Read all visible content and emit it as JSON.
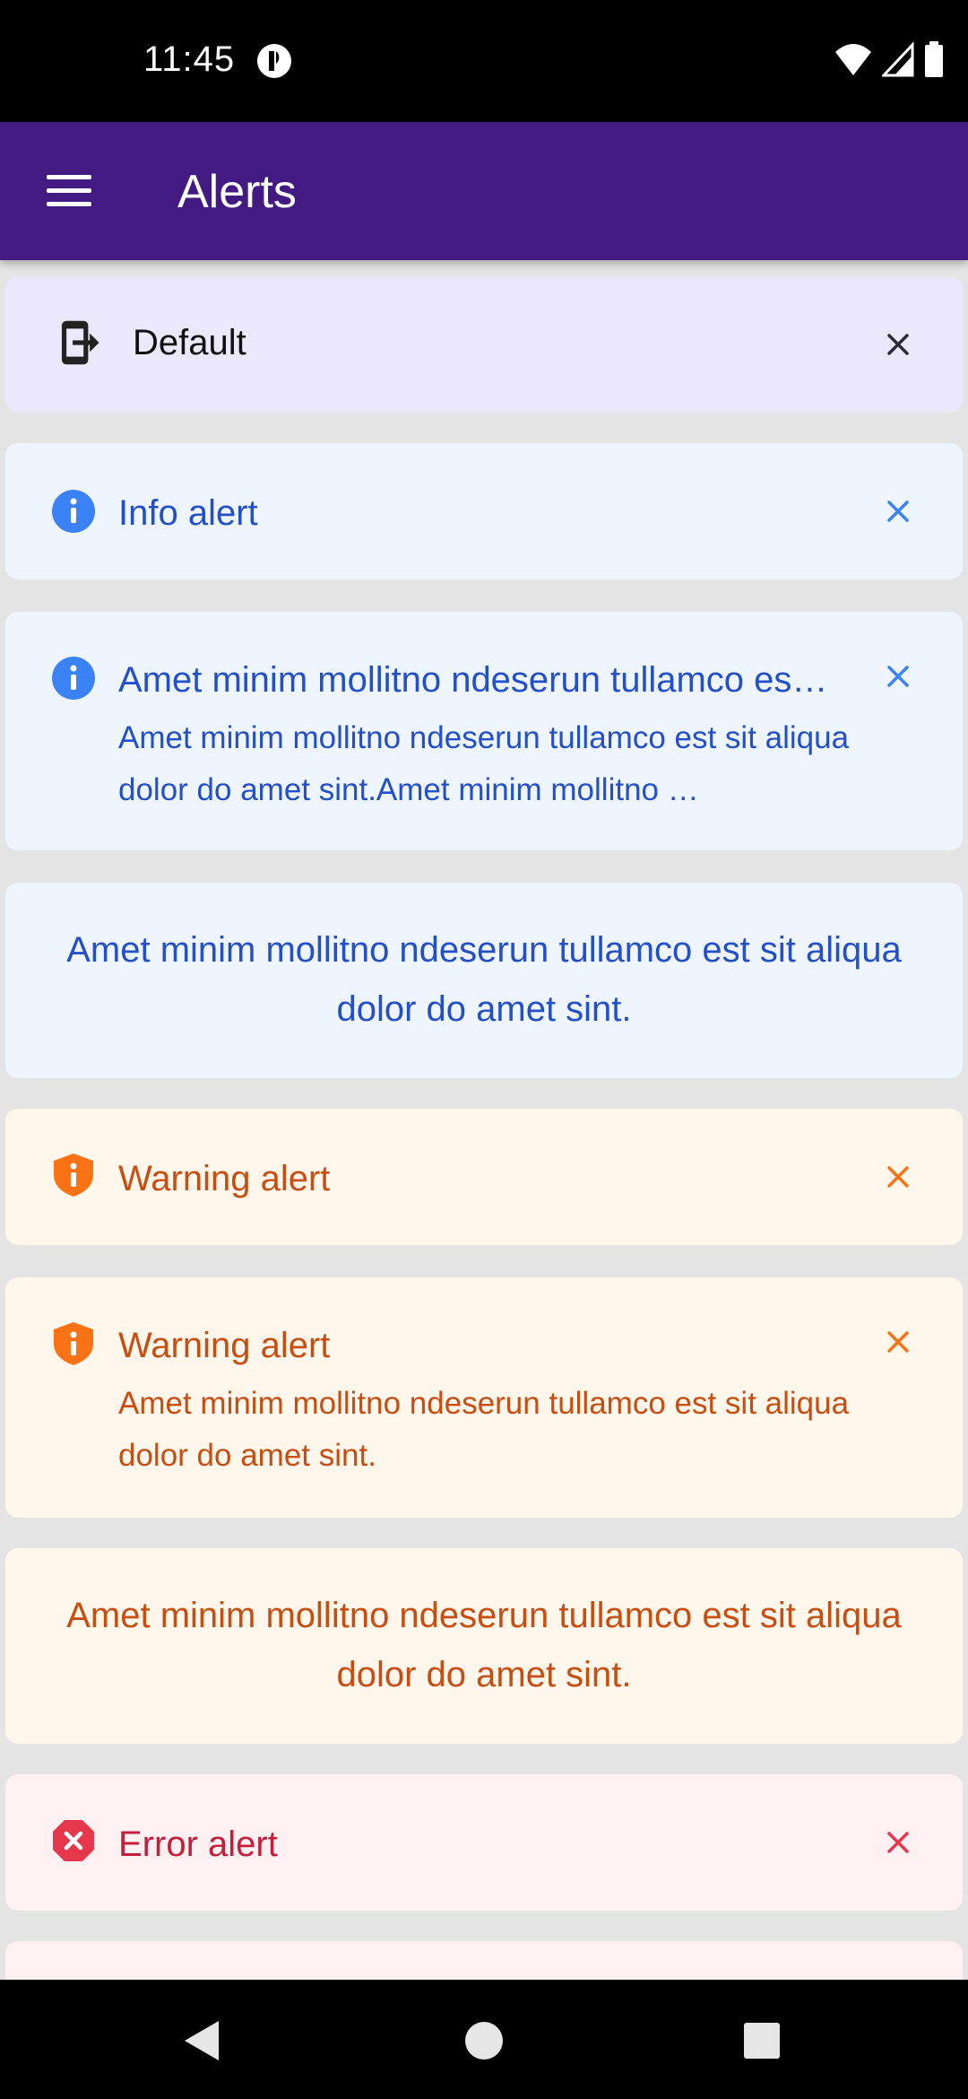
{
  "status_bar": {
    "time": "11:45"
  },
  "app_bar": {
    "title": "Alerts"
  },
  "alerts": [
    {
      "variant": "default",
      "title": "Default",
      "icon": "exit-icon",
      "closable": true
    },
    {
      "variant": "info",
      "title": "Info alert",
      "icon": "info-icon",
      "closable": true
    },
    {
      "variant": "info",
      "title": "Amet minim mollitno ndeserun tullamco es…",
      "description": "Amet minim mollitno ndeserun tullamco est sit aliqua dolor do amet sint.Amet minim mollitno …",
      "icon": "info-icon",
      "closable": true
    },
    {
      "variant": "info",
      "text": "Amet minim mollitno ndeserun tullamco est sit aliqua dolor do amet sint."
    },
    {
      "variant": "warning",
      "title": "Warning alert",
      "icon": "shield-info-icon",
      "closable": true
    },
    {
      "variant": "warning",
      "title": "Warning alert",
      "description": "Amet minim mollitno ndeserun tullamco est sit aliqua dolor do amet sint.",
      "icon": "shield-info-icon",
      "closable": true
    },
    {
      "variant": "warning",
      "text": "Amet minim mollitno ndeserun tullamco est sit aliqua dolor do amet sint."
    },
    {
      "variant": "error",
      "title": "Error alert",
      "icon": "error-x-icon",
      "closable": true
    }
  ],
  "colors": {
    "app_bar": "#421a82",
    "info_text": "#2350c9",
    "info_icon": "#3b82f6",
    "warning_text": "#c84d10",
    "warning_icon": "#f97316",
    "error_text": "#c41f3a",
    "error_icon": "#e5384d"
  }
}
